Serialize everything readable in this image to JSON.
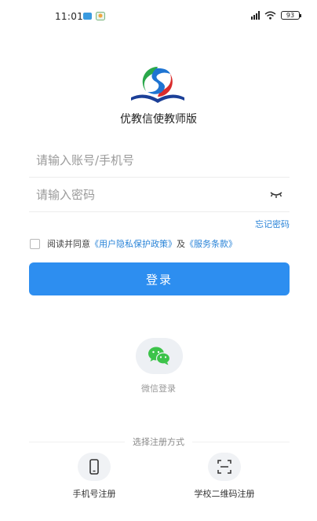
{
  "status_bar": {
    "time": "11:01",
    "battery": "93"
  },
  "app": {
    "name": "优教信使教师版"
  },
  "login": {
    "account_placeholder": "请输入账号/手机号",
    "password_placeholder": "请输入密码",
    "forgot_password": "忘记密码",
    "agree_prefix": "阅读并同意",
    "privacy_link": "《用户隐私保护政策》",
    "agree_and": "及",
    "terms_link": "《服务条款》",
    "login_button": "登录",
    "wechat_login": "微信登录"
  },
  "register": {
    "title": "选择注册方式",
    "phone_label": "手机号注册",
    "qr_label": "学校二维码注册"
  },
  "colors": {
    "primary": "#2d8ef0",
    "link": "#2a84d8",
    "wechat": "#3cc34a"
  },
  "icons": [
    "wifi-icon",
    "signal-icon",
    "battery-icon",
    "eye-closed-icon",
    "wechat-icon",
    "phone-icon",
    "qr-scan-icon"
  ]
}
